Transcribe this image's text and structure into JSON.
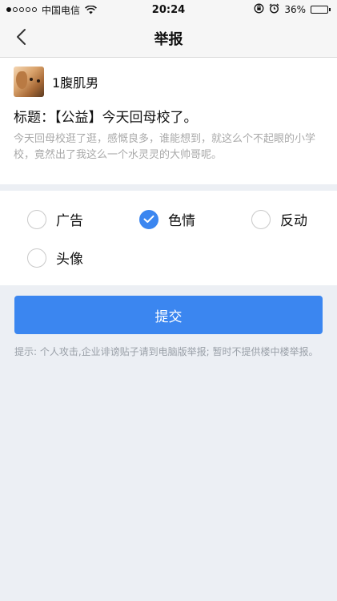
{
  "status_bar": {
    "carrier": "中国电信",
    "time": "20:24",
    "battery_percent": "36%",
    "battery_level": 0.36,
    "icons": [
      "signal-dots-icon",
      "wifi-icon",
      "orientation-lock-icon",
      "alarm-icon",
      "battery-icon"
    ]
  },
  "nav": {
    "title": "举报",
    "back_icon": "chevron-left-icon"
  },
  "post": {
    "author": "1腹肌男",
    "title": "标题：【公益】今天回母校了。",
    "excerpt": "今天回母校逛了逛，感慨良多，谁能想到，就这么个不起眼的小学校，竟然出了我这么一个水灵灵的大帅哥呢。"
  },
  "options": [
    {
      "label": "广告",
      "checked": false
    },
    {
      "label": "色情",
      "checked": true
    },
    {
      "label": "反动",
      "checked": false
    },
    {
      "label": "头像",
      "checked": false
    }
  ],
  "submit_label": "提交",
  "tip": "提示: 个人攻击,企业诽谤贴子请到电脑版举报; 暂时不提供楼中楼举报。",
  "colors": {
    "accent": "#3b86f0",
    "page_background": "#eceff4",
    "muted_text": "#a9a9a9"
  }
}
